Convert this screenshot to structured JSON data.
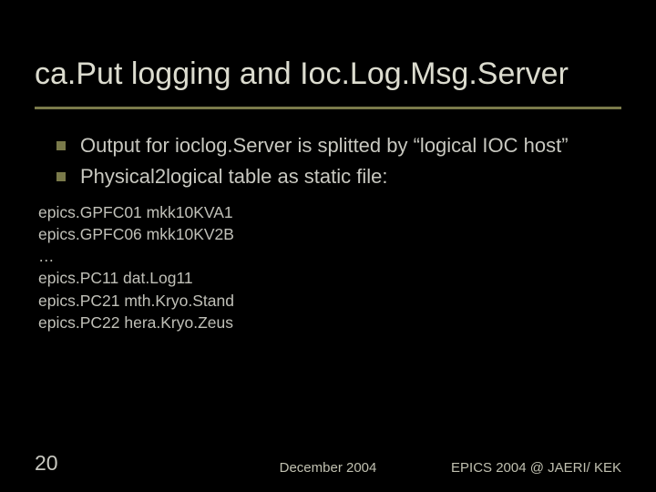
{
  "title": "ca.Put logging and Ioc.Log.Msg.Server",
  "bullets": [
    "Output for ioclog.Server is splitted by “logical IOC host”",
    "Physical2logical table as static file:"
  ],
  "code_lines": [
    "epics.GPFC01 mkk10KVA1",
    "epics.GPFC06 mkk10KV2B",
    "…",
    "epics.PC11 dat.Log11",
    "epics.PC21 mth.Kryo.Stand",
    "epics.PC22 hera.Kryo.Zeus"
  ],
  "footer": {
    "page": "20",
    "center": "December 2004",
    "right": "EPICS 2004 @ JAERI/ KEK"
  }
}
